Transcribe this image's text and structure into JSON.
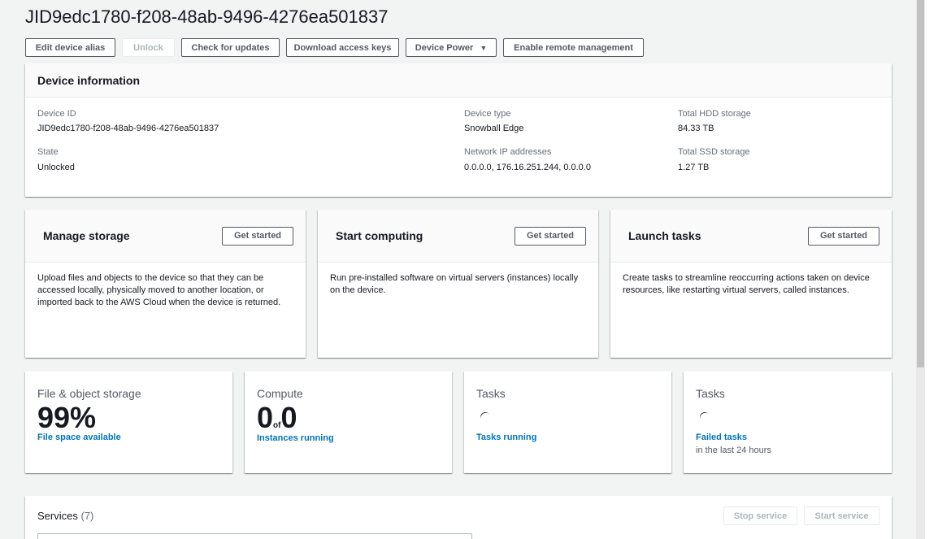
{
  "page": {
    "title": "JID9edc1780-f208-48ab-9496-4276ea501837"
  },
  "toolbar": {
    "edit_alias": "Edit device alias",
    "unlock": "Unlock",
    "check_updates": "Check for updates",
    "download_keys": "Download access keys",
    "device_power": "Device Power",
    "enable_remote": "Enable remote management"
  },
  "device_info": {
    "title": "Device information",
    "device_id_label": "Device ID",
    "device_id": "JID9edc1780-f208-48ab-9496-4276ea501837",
    "state_label": "State",
    "state": "Unlocked",
    "device_type_label": "Device type",
    "device_type": "Snowball Edge",
    "network_label": "Network IP addresses",
    "network": "0.0.0.0, 176.16.251.244, 0.0.0.0",
    "hdd_label": "Total HDD storage",
    "hdd": "84.33 TB",
    "ssd_label": "Total SSD storage",
    "ssd": "1.27 TB"
  },
  "features": [
    {
      "title": "Manage storage",
      "button": "Get started",
      "description": "Upload files and objects to the device so that they can be accessed locally, physically moved to another location, or imported back to the AWS Cloud when the device is returned."
    },
    {
      "title": "Start computing",
      "button": "Get started",
      "description": "Run pre-installed software on virtual servers (instances) locally on the device."
    },
    {
      "title": "Launch tasks",
      "button": "Get started",
      "description": "Create tasks to streamline reoccurring actions taken on device resources, like restarting virtual servers, called instances."
    }
  ],
  "metrics": {
    "storage": {
      "label": "File & object storage",
      "value": "99%",
      "link": "File space available"
    },
    "compute": {
      "label": "Compute",
      "value_a": "0",
      "of": "of",
      "value_b": "0",
      "link": "Instances running"
    },
    "tasks": {
      "label": "Tasks",
      "link": "Tasks running"
    },
    "failed": {
      "label": "Tasks",
      "link": "Failed tasks",
      "sub": "in the last 24 hours"
    }
  },
  "services": {
    "title": "Services",
    "count": "(7)",
    "stop": "Stop service",
    "start": "Start service"
  }
}
